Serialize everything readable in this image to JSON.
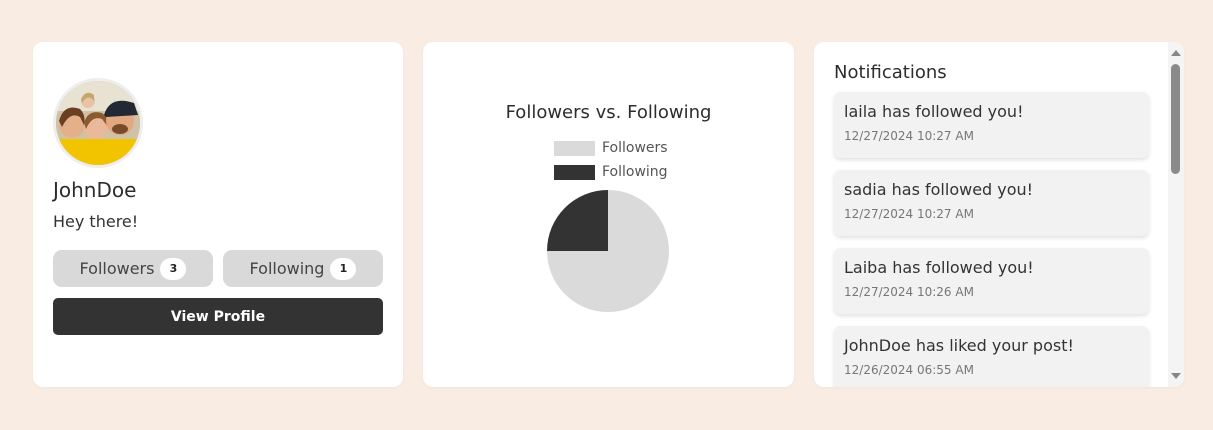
{
  "profile": {
    "username": "JohnDoe",
    "bio": "Hey there!",
    "followers_label": "Followers",
    "followers_count": "3",
    "following_label": "Following",
    "following_count": "1",
    "view_profile_label": "View Profile"
  },
  "chart_data": {
    "type": "pie",
    "title": "Followers vs. Following",
    "categories": [
      "Followers",
      "Following"
    ],
    "values": [
      3,
      1
    ],
    "colors": [
      "#dadada",
      "#333333"
    ],
    "legend_position": "top"
  },
  "notifications": {
    "heading": "Notifications",
    "items": [
      {
        "text": "laila has followed you!",
        "time": "12/27/2024 10:27 AM"
      },
      {
        "text": "sadia has followed you!",
        "time": "12/27/2024 10:27 AM"
      },
      {
        "text": "Laiba has followed you!",
        "time": "12/27/2024 10:26 AM"
      },
      {
        "text": "JohnDoe has liked your post!",
        "time": "12/26/2024 06:55 AM"
      }
    ]
  }
}
